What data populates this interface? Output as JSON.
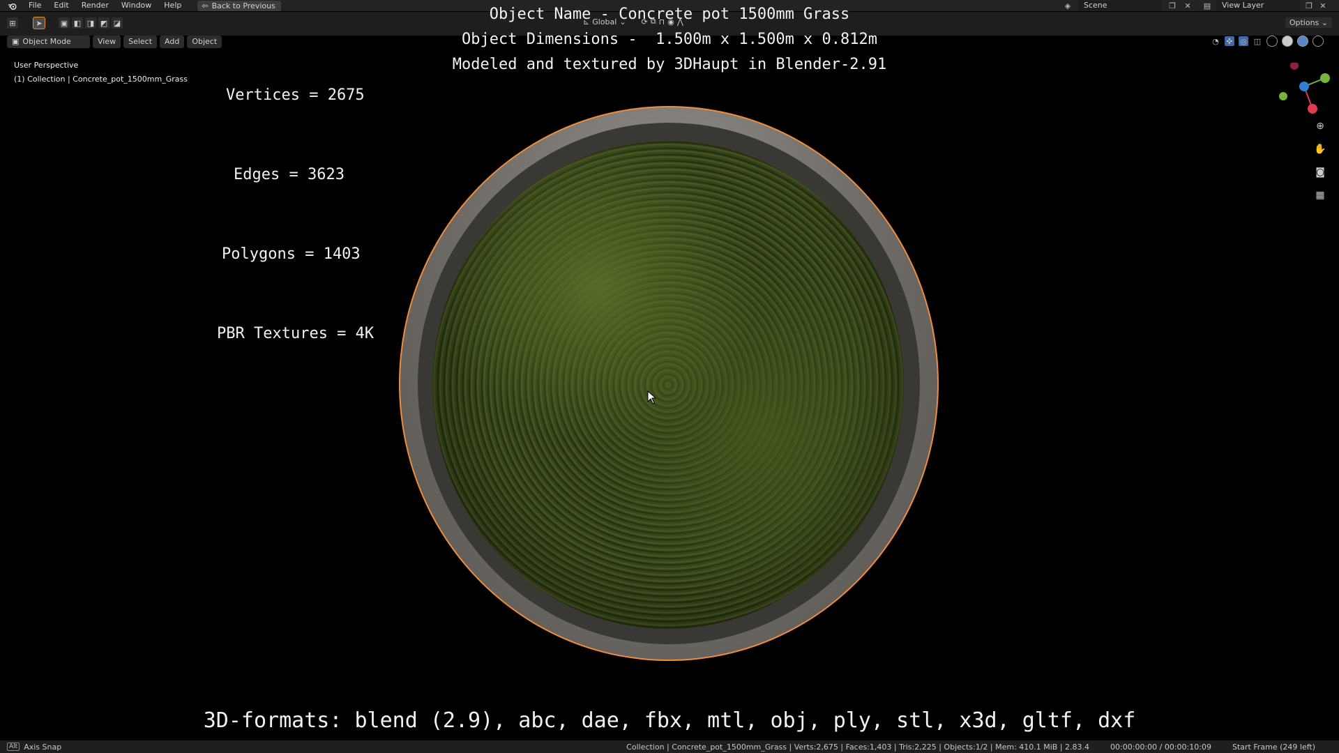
{
  "menu": {
    "items": [
      "File",
      "Edit",
      "Render",
      "Window",
      "Help"
    ],
    "back_label": "Back to Previous"
  },
  "scene": {
    "label": "Scene",
    "view_layer": "View Layer"
  },
  "toolbar": {
    "orientation": "Global",
    "options_label": "Options"
  },
  "viewport_header": {
    "mode": "Object Mode",
    "view": "View",
    "select": "Select",
    "add": "Add",
    "object": "Object"
  },
  "viewport_info": {
    "perspective": "User Perspective",
    "collection": "(1) Collection | Concrete_pot_1500mm_Grass"
  },
  "overlay": {
    "title": "Object Name - Concrete pot 1500mm Grass",
    "dimensions": "Object Dimensions -  1.500m x 1.500m x 0.812m",
    "modeled_by": "Modeled and textured by 3DHaupt in Blender-2.91",
    "vertices": "Vertices = 2675",
    "edges": "Edges = 3623",
    "polygons": "Polygons = 1403",
    "textures": "PBR Textures = 4K",
    "formats": "3D-formats: blend (2.9), abc, dae, fbx, mtl, obj, ply, stl, x3d, gltf, dxf"
  },
  "statusbar": {
    "key": "Alt",
    "axis_snap": "Axis Snap",
    "info": "Collection | Concrete_pot_1500mm_Grass | Verts:2,675 | Faces:1,403 | Tris:2,225 | Objects:1/2 | Mem: 410.1 MiB | 2.83.4",
    "time": "00:00:00:00 / 00:00:10:09",
    "frame": "Start Frame (249 left)"
  },
  "colors": {
    "selection_outline": "#f08d3c",
    "background": "#000000"
  },
  "gizmo": {
    "x_color": "#e03a4f",
    "y_color": "#76b53a",
    "z_color": "#2f7fd6"
  }
}
